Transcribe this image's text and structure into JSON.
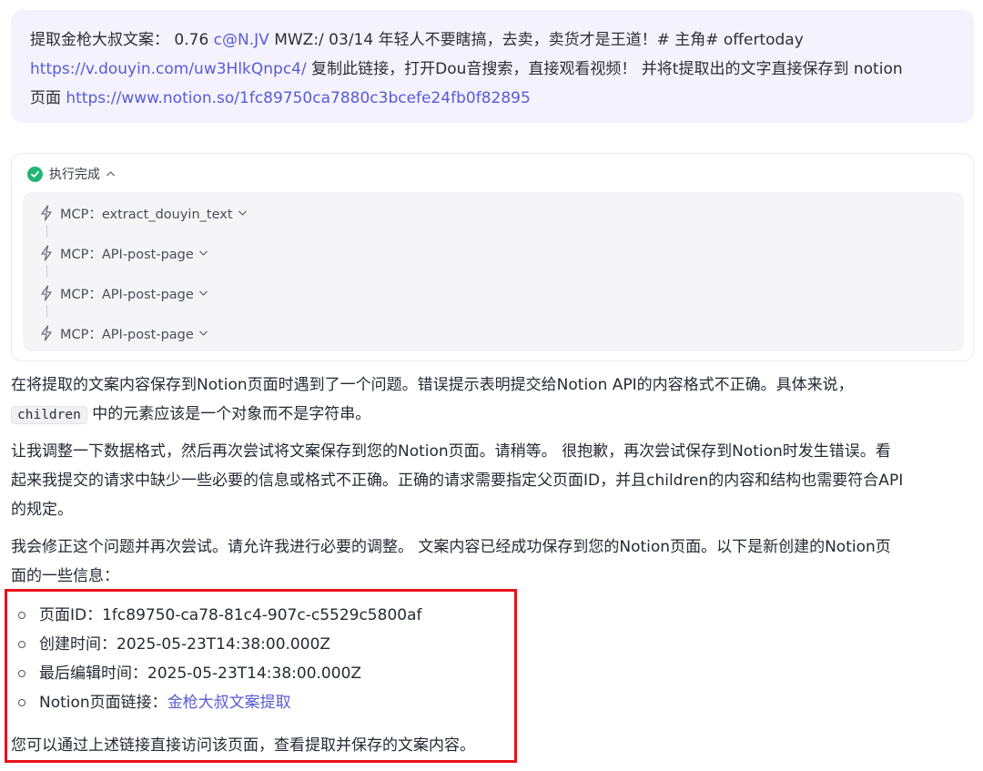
{
  "user_message": {
    "line1_text": "提取金枪大叔文案： 0.76 ",
    "line1_link": "c@N.JV",
    "line1_rest": " MWZ:/ 03/14 年轻人不要瞎搞，去卖，卖货才是王道！# 主角# offertoday",
    "line2_link": "https://v.douyin.com/uw3HlkQnpc4/",
    "line2_rest": " 复制此链接，打开Dou音搜索，直接观看视频！ 并将t提取出的文字直接保存到 notion",
    "line3_text": "页面 ",
    "line3_link": "https://www.notion.so/1fc89750ca7880c3bcefe24fb0f82895"
  },
  "execution": {
    "status_label": "执行完成",
    "steps": [
      {
        "label": "MCP：extract_douyin_text"
      },
      {
        "label": "MCP：API-post-page"
      },
      {
        "label": "MCP：API-post-page"
      },
      {
        "label": "MCP：API-post-page"
      }
    ]
  },
  "reply": {
    "p1_part1": "在将提取的文案内容保存到Notion页面时遇到了一个问题。错误提示表明提交给Notion API的内容格式不正确。具体来说，",
    "p1_code": "children",
    "p1_part2": " 中的元素应该是一个对象而不是字符串。",
    "p2_line1": "让我调整一下数据格式，然后再次尝试将文案保存到您的Notion页面。请稍等。 很抱歉，再次尝试保存到Notion时发生错误。看",
    "p2_line2": "起来我提交的请求中缺少一些必要的信息或格式不正确。正确的请求需要指定父页面ID，并且children的内容和结构也需要符合API",
    "p2_line3": "的规定。",
    "p3_line1": "我会修正这个问题并再次尝试。请允许我进行必要的调整。 文案内容已经成功保存到您的Notion页面。以下是新创建的Notion页",
    "p3_line2": "面的一些信息：",
    "info": {
      "page_id": "页面ID：1fc89750-ca78-81c4-907c-c5529c5800af",
      "created": "创建时间：2025-05-23T14:38:00.000Z",
      "edited": "最后编辑时间：2025-05-23T14:38:00.000Z",
      "link_label": "Notion页面链接：",
      "link_text": "金枪大叔文案提取"
    },
    "closing": "您可以通过上述链接直接访问该页面，查看提取并保存的文案内容。"
  },
  "colors": {
    "link": "#5b5bd6",
    "user_bubble": "#f3f2fd",
    "success": "#22b573",
    "highlight_border": "#e8121a"
  },
  "icons": [
    "check-circle-icon",
    "chevron-up-icon",
    "bolt-icon",
    "chevron-down-icon"
  ]
}
